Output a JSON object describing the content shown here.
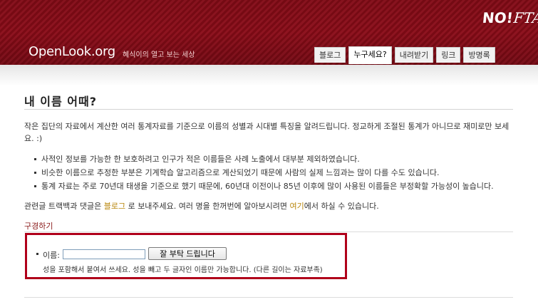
{
  "header": {
    "logo": "OpenLook.org",
    "tagline": "혜식이의 열고 보는 세상",
    "badge_main": "NO!",
    "badge_suffix": "FTA"
  },
  "tabs": [
    {
      "label": "블로그",
      "active": false
    },
    {
      "label": "누구세요?",
      "active": true
    },
    {
      "label": "내려받기",
      "active": false
    },
    {
      "label": "링크",
      "active": false
    },
    {
      "label": "방명록",
      "active": false
    }
  ],
  "page": {
    "title": "내 이름 어때?",
    "intro": "작은 집단의 자료에서 계산한 여러 통계자료를 기준으로 이름의 성별과 시대별 특징을 알려드립니다. 정교하게 조절된 통계가 아니므로 재미로만 보세요. :)",
    "bullets": [
      "사적인 정보를 가능한 한 보호하려고 인구가 적은 이름들은 사례 노출에서 대부분 제외하였습니다.",
      "비슷한 이름으로 추정한 부분은 기계학습 알고리즘으로 계산되었기 때문에 사람의 실제 느낌과는 많이 다를 수도 있습니다.",
      "통계 자료는 주로 70년대 태생을 기준으로 했기 때문에, 60년대 이전이나 85년 이후에 많이 사용된 이름들은 부정확할 가능성이 높습니다."
    ],
    "related_prefix": "관련글 트랙백과 댓글은 ",
    "related_link1": "블로그",
    "related_middle": " 로 보내주세요. 여러 명을 한꺼번에 알아보시려면 ",
    "related_link2": "여기",
    "related_suffix": "에서 하실 수 있습니다.",
    "section_title": "구경하기"
  },
  "form": {
    "name_label": "이름:",
    "name_value": "",
    "submit_label": "잘 부탁 드립니다",
    "hint": "성을 포함해서 붙여서 쓰세요. 성을 빼고 두 글자인 이름만 가능합니다. (다른 길이는 자료부족)"
  },
  "colors": {
    "header_bg": "#7a0a14",
    "highlight_border": "#b0001a",
    "link": "#b8860b",
    "section_title": "#8a1a1a"
  }
}
